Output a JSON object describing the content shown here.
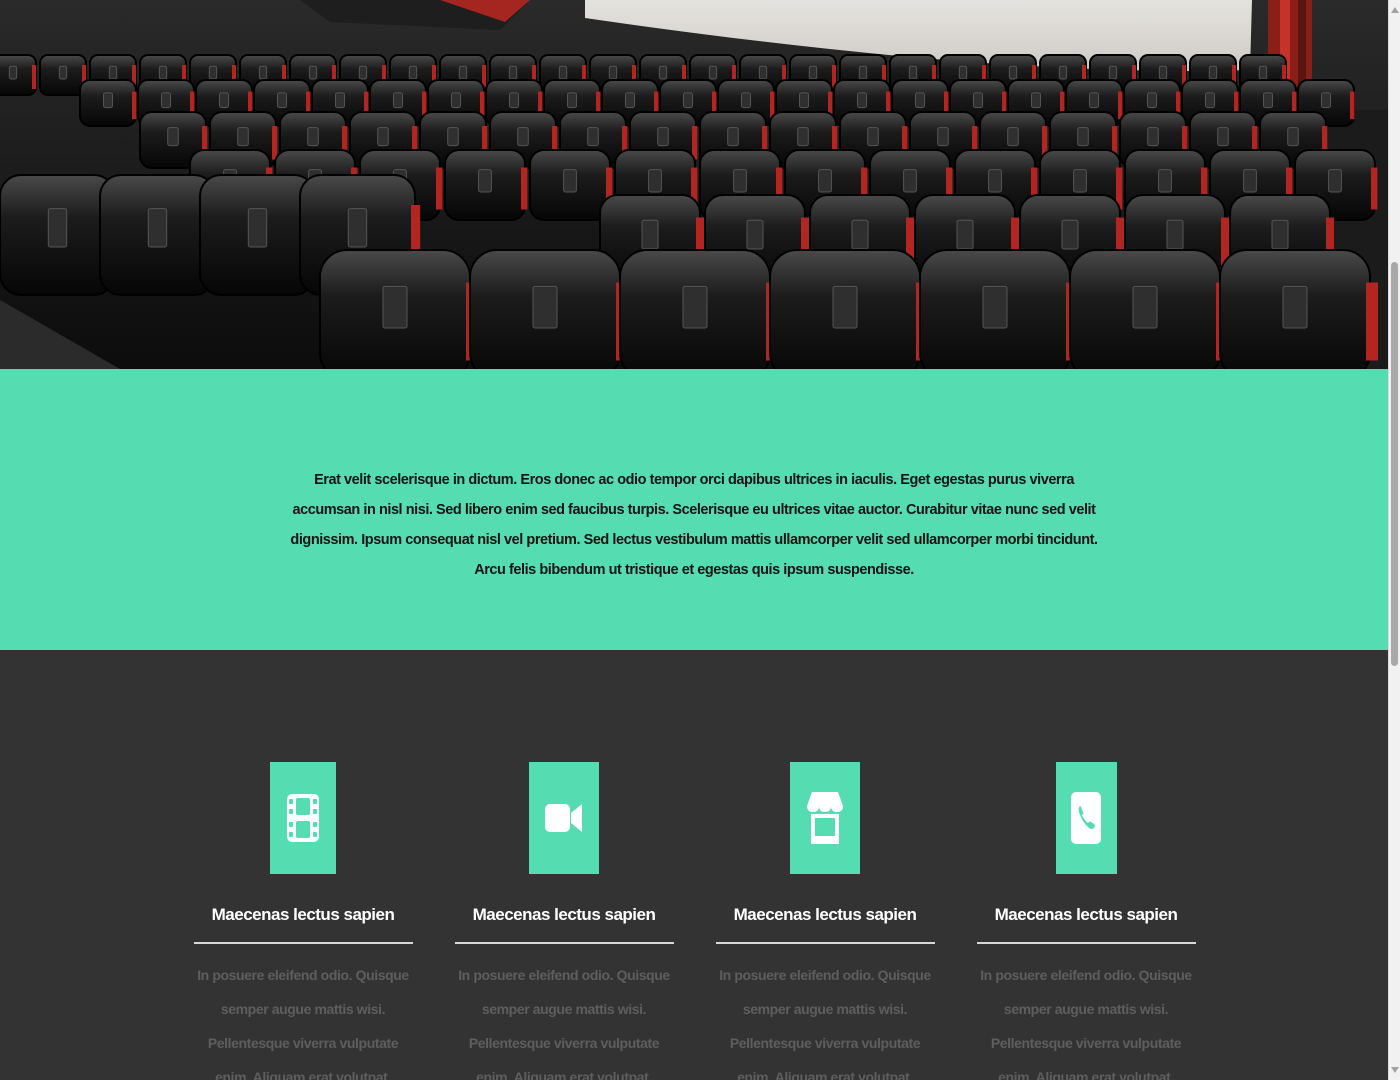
{
  "hero": {
    "image": "cinema-seats-photo"
  },
  "intro": {
    "text": "Erat velit scelerisque in dictum. Eros donec ac odio tempor orci dapibus ultrices in iaculis. Eget egestas purus viverra accumsan in nisl nisi. Sed libero enim sed faucibus turpis. Scelerisque eu ultrices vitae auctor. Curabitur vitae nunc sed velit dignissim. Ipsum consequat nisl vel pretium. Sed lectus vestibulum mattis ullamcorper velit sed ullamcorper morbi tincidunt. Arcu felis bibendum ut tristique et egestas quis ipsum suspendisse."
  },
  "features": [
    {
      "icon": "film-icon",
      "title": "Maecenas lectus sapien",
      "description": "In posuere eleifend odio. Quisque semper augue mattis wisi. Pellentesque viverra vulputate enim. Aliquam erat volutpat."
    },
    {
      "icon": "video-camera-icon",
      "title": "Maecenas lectus sapien",
      "description": "In posuere eleifend odio. Quisque semper augue mattis wisi. Pellentesque viverra vulputate enim. Aliquam erat volutpat."
    },
    {
      "icon": "store-icon",
      "title": "Maecenas lectus sapien",
      "description": "In posuere eleifend odio. Quisque semper augue mattis wisi. Pellentesque viverra vulputate enim. Aliquam erat volutpat."
    },
    {
      "icon": "phone-icon",
      "title": "Maecenas lectus sapien",
      "description": "In posuere eleifend odio. Quisque semper augue mattis wisi. Pellentesque viverra vulputate enim. Aliquam erat volutpat."
    }
  ],
  "colors": {
    "accent": "#55dcb0",
    "dark_background": "#333333",
    "title_text": "#ffffff",
    "muted_text": "#5e5e5e"
  }
}
